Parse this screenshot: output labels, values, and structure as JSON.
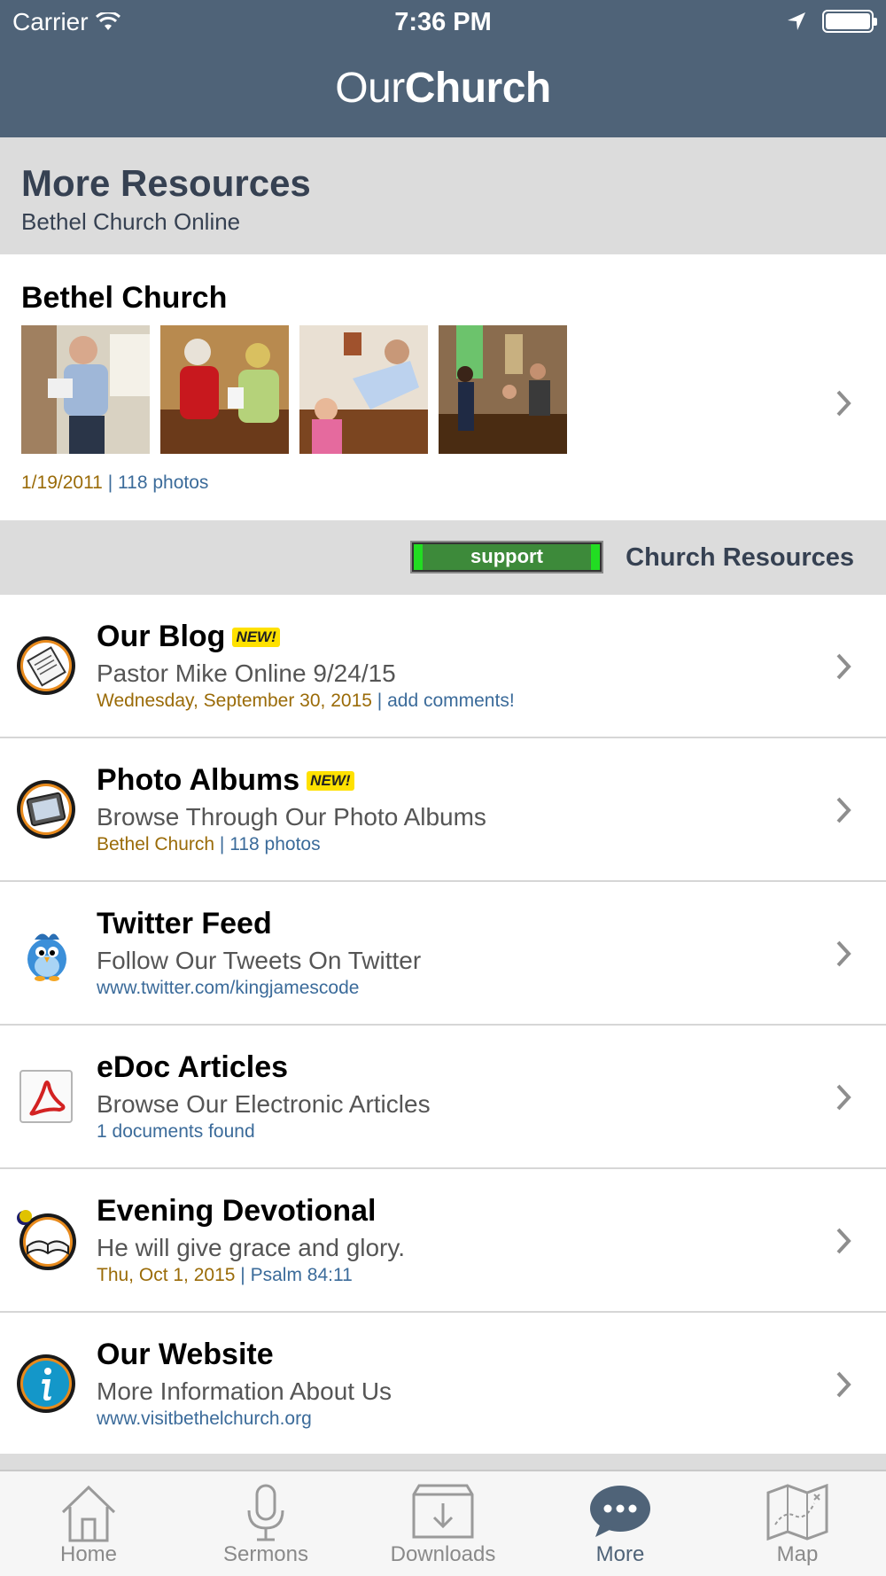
{
  "status_bar": {
    "carrier": "Carrier",
    "time": "7:36 PM"
  },
  "app": {
    "brand_light": "Our",
    "brand_bold": "Church"
  },
  "section": {
    "title": "More Resources",
    "subtitle": "Bethel Church Online"
  },
  "album": {
    "title": "Bethel Church",
    "date": "1/19/2011",
    "separator": "|",
    "count": "118 photos"
  },
  "resources_bar": {
    "support_label": "support",
    "label": "Church Resources"
  },
  "items": [
    {
      "title": "Our Blog",
      "badge": "NEW!",
      "desc": "Pastor Mike Online 9/24/15",
      "meta_gold": "Wednesday, September 30, 2015",
      "meta_sep": "|",
      "meta_blue": "add comments!",
      "icon": "blog-notepad-icon"
    },
    {
      "title": "Photo Albums",
      "badge": "NEW!",
      "desc": "Browse Through Our Photo Albums",
      "meta_gold": "Bethel Church",
      "meta_sep": "|",
      "meta_blue": "118 photos",
      "icon": "photo-frame-icon"
    },
    {
      "title": "Twitter Feed",
      "badge": "",
      "desc": "Follow Our Tweets On Twitter",
      "meta_gold": "",
      "meta_sep": "",
      "meta_blue": "www.twitter.com/kingjamescode",
      "icon": "twitter-bird-icon"
    },
    {
      "title": "eDoc Articles",
      "badge": "",
      "desc": "Browse Our Electronic Articles",
      "meta_gold": "",
      "meta_sep": "",
      "meta_blue": "1 documents found",
      "icon": "pdf-document-icon"
    },
    {
      "title": "Evening Devotional",
      "badge": "",
      "desc": "He will give grace and glory.",
      "meta_gold": "Thu, Oct 1, 2015",
      "meta_sep": "|",
      "meta_blue": "Psalm 84:11",
      "icon": "open-bible-icon"
    },
    {
      "title": "Our Website",
      "badge": "",
      "desc": "More Information About Us",
      "meta_gold": "",
      "meta_sep": "",
      "meta_blue": "www.visitbethelchurch.org",
      "icon": "info-icon"
    }
  ],
  "tabs": [
    {
      "label": "Home",
      "icon": "home-icon"
    },
    {
      "label": "Sermons",
      "icon": "microphone-icon"
    },
    {
      "label": "Downloads",
      "icon": "download-box-icon"
    },
    {
      "label": "More",
      "icon": "chat-bubble-icon",
      "active": true
    },
    {
      "label": "Map",
      "icon": "map-icon"
    }
  ],
  "colors": {
    "header": "#4f6378",
    "meta_gold": "#9a6b08",
    "meta_blue": "#3b6b9a",
    "badge": "#ffe100"
  }
}
